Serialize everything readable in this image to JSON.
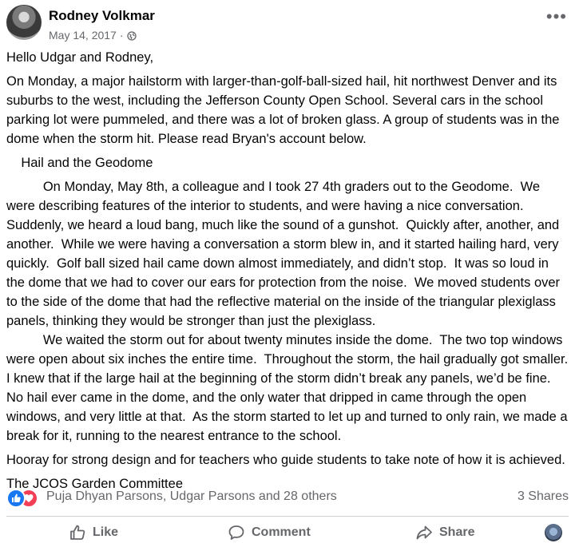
{
  "post": {
    "author": "Rodney Volkmar",
    "date": "May 14, 2017",
    "separator": "·",
    "audience_icon": "globe-icon",
    "more_icon": "•••",
    "paragraphs": [
      "Hello Udgar and Rodney,",
      "On Monday, a major hailstorm with larger-than-golf-ball-sized hail, hit northwest Denver and its suburbs to the west, including the Jefferson County Open School. Several cars in the school parking lot were pummeled, and there was a lot of broken glass. A group of students was in the dome when the storm hit. Please read Bryan's account below.",
      "    Hail and the Geodome",
      "          On Monday, May 8th, a colleague and I took 27 4th graders out to the Geodome.  We were describing features of the interior to students, and were having a nice conversation. Suddenly, we heard a loud bang, much like the sound of a gunshot.  Quickly after, another, and another.  While we were having a conversation a storm blew in, and it started hailing hard, very quickly.  Golf ball sized hail came down almost immediately, and didn’t stop.  It was so loud in the dome that we had to cover our ears for protection from the noise.  We moved students over to the side of the dome that had the reflective material on the inside of the triangular plexiglass panels, thinking they would be stronger than just the plexiglass.",
      "          We waited the storm out for about twenty minutes inside the dome.  The two top windows were open about six inches the entire time.  Throughout the storm, the hail gradually got smaller.  I knew that if the large hail at the beginning of the storm didn’t break any panels, we’d be fine. No hail ever came in the dome, and the only water that dripped in came through the open windows, and very little at that.  As the storm started to let up and turned to only rain, we made a break for it, running to the nearest entrance to the school.",
      "Hooray for strong design and for teachers who guide students to take note of how it is achieved.",
      "The JCOS Garden Committee"
    ]
  },
  "stats": {
    "reactors": "Puja Dhyan Parsons, Udgar Parsons and 28 others",
    "shares": "3 Shares",
    "reaction_icons": [
      "like-icon",
      "love-icon"
    ]
  },
  "actions": {
    "like": "Like",
    "comment": "Comment",
    "share": "Share"
  },
  "colors": {
    "like_blue": "#1877f2",
    "love_red": "#f33e58",
    "secondary_text": "#65676b"
  }
}
